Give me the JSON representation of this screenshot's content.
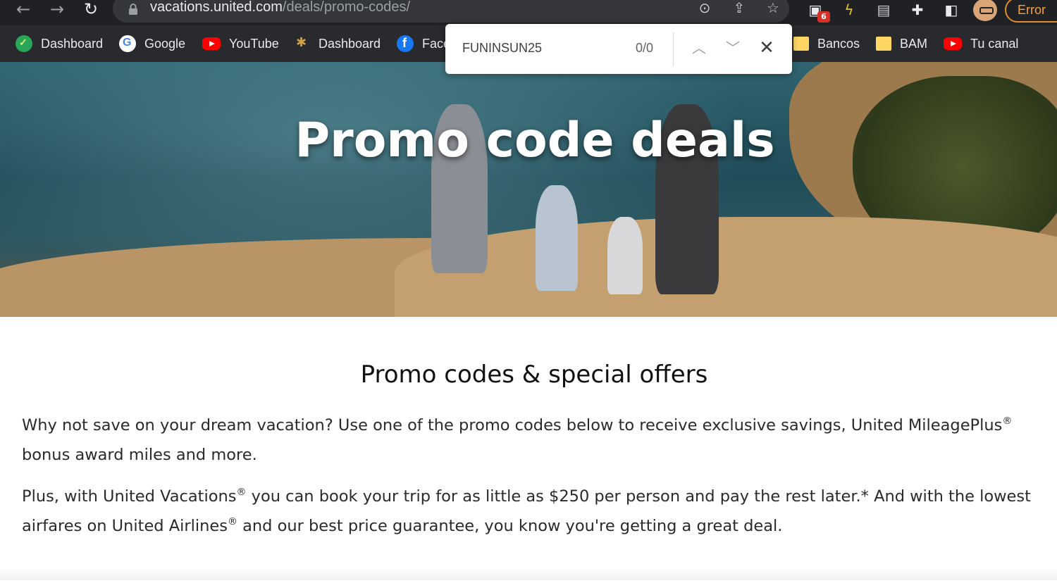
{
  "browser": {
    "url_domain": "vacations.united.com",
    "url_path": "/deals/promo-codes/",
    "extension_badge": "6",
    "error_chip": "Error",
    "icons": [
      "back-icon",
      "forward-icon",
      "reload-icon",
      "lock-icon",
      "zoom-icon",
      "share-icon",
      "star-icon",
      "extension-icon",
      "puzzle-icon",
      "sidepanel-icon"
    ]
  },
  "bookmarks": [
    {
      "label": "Dashboard",
      "icon": "dashboard-icon"
    },
    {
      "label": "Google",
      "icon": "google-icon"
    },
    {
      "label": "YouTube",
      "icon": "youtube-icon"
    },
    {
      "label": "Dashboard",
      "icon": "palm-icon"
    },
    {
      "label": "Face",
      "icon": "facebook-icon"
    },
    {
      "label": "Bancos",
      "icon": "folder-icon"
    },
    {
      "label": "BAM",
      "icon": "folder-icon"
    },
    {
      "label": "Tu canal",
      "icon": "youtube-icon"
    }
  ],
  "find_bar": {
    "query": "FUNINSUN25",
    "count": "0/0"
  },
  "hero": {
    "title": "Promo code deals"
  },
  "content": {
    "section_title": "Promo codes & special offers",
    "p1_part1": "Why not save on your dream vacation? Use one of the promo codes below to receive exclusive savings, United MileagePlus",
    "p1_sup": "®",
    "p1_part2": " bonus award miles and more.",
    "p2_part1": "Plus, with United Vacations",
    "p2_sup1": "®",
    "p2_part2": " you can book your trip for as little as $250 per person and pay the rest later.* And with the lowest airfares on United Airlines",
    "p2_sup2": "®",
    "p2_part3": " and our best price guarantee, you know you're getting a great deal."
  },
  "colors": {
    "toolbar_bg": "#202124",
    "bookmarks_bg": "#292a2d",
    "error_accent": "#e38b2c"
  }
}
